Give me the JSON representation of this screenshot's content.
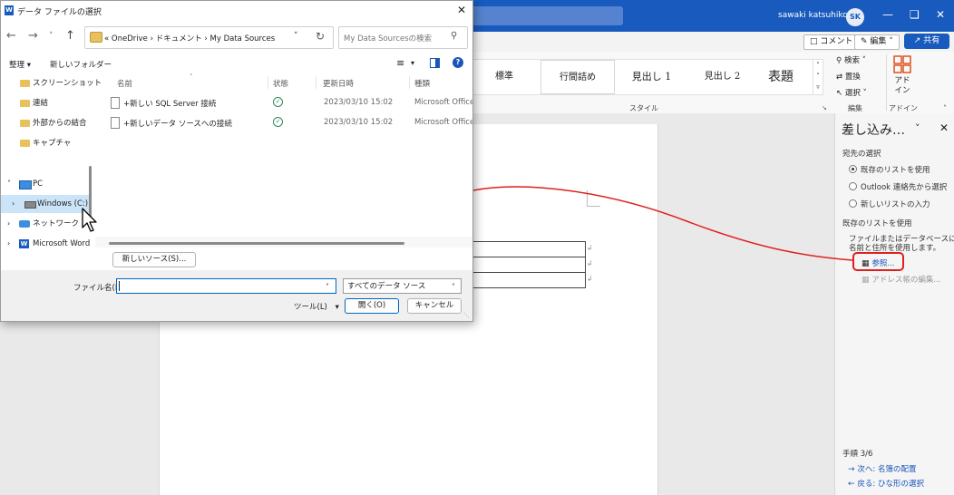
{
  "word": {
    "user_name": "sawaki katsuhiko",
    "user_initials": "SK",
    "comment_button": "コメント",
    "edit_button": "編集",
    "share_button": "共有",
    "styles": [
      "標準",
      "行間詰め",
      "見出し 1",
      "見出し 2",
      "表題"
    ],
    "styles_group_label": "スタイル",
    "edit_group": {
      "find": "検索",
      "replace": "置換",
      "select": "選択",
      "label": "編集"
    },
    "addin_group": {
      "button": "アド\nイン",
      "label": "アドイン"
    }
  },
  "mail_merge": {
    "title": "差し込み…",
    "recipients_heading": "宛先の選択",
    "options": [
      "既存のリストを使用",
      "Outlook 連絡先から選択",
      "新しいリストの入力"
    ],
    "selected_option": 0,
    "existing_list_heading": "既存のリストを使用",
    "existing_list_description": [
      "ファイルまたはデータベースにある",
      "名前と住所を使用します。"
    ],
    "browse_link": "参照...",
    "edit_address_link": "アドレス帳の編集...",
    "step_label": "手順 3/6",
    "next_link": "次へ: 名簿の配置",
    "back_link": "戻る: ひな形の選択"
  },
  "dialog": {
    "title": "データ ファイルの選択",
    "breadcrumb": [
      "OneDrive",
      "ドキュメント",
      "My Data Sources"
    ],
    "breadcrumb_prefix": "«",
    "search_placeholder": "My Data Sourcesの検索",
    "organize_label": "整理",
    "new_folder_label": "新しいフォルダー",
    "nav_items": [
      {
        "label": "スクリーンショット",
        "type": "folder"
      },
      {
        "label": "連結",
        "type": "folder"
      },
      {
        "label": "外部からの結合",
        "type": "folder"
      },
      {
        "label": "キャプチャ",
        "type": "folder"
      },
      {
        "label": "PC",
        "type": "pc"
      },
      {
        "label": "Windows (C:)",
        "type": "drive"
      },
      {
        "label": "ネットワーク",
        "type": "network"
      },
      {
        "label": "Microsoft Word",
        "type": "word"
      }
    ],
    "columns": [
      "名前",
      "状態",
      "更新日時",
      "種類"
    ],
    "files": [
      {
        "name": "+新しい SQL Server 接続",
        "modified": "2023/03/10 15:02",
        "type": "Microsoft Office D"
      },
      {
        "name": "+新しいデータ ソースへの接続",
        "modified": "2023/03/10 15:02",
        "type": "Microsoft Office D"
      }
    ],
    "new_source_button": "新しいソース(S)...",
    "filename_label": "ファイル名(N):",
    "filename_value": "",
    "filetype_value": "すべてのデータ ソース",
    "tools_label": "ツール(L)",
    "open_button": "開く(O)",
    "cancel_button": "キャンセル"
  },
  "colors": {
    "word_blue": "#185abd",
    "annotation_red": "#e0201c",
    "ok_green": "#2e8b57",
    "selection_blue": "#cce4f7"
  }
}
